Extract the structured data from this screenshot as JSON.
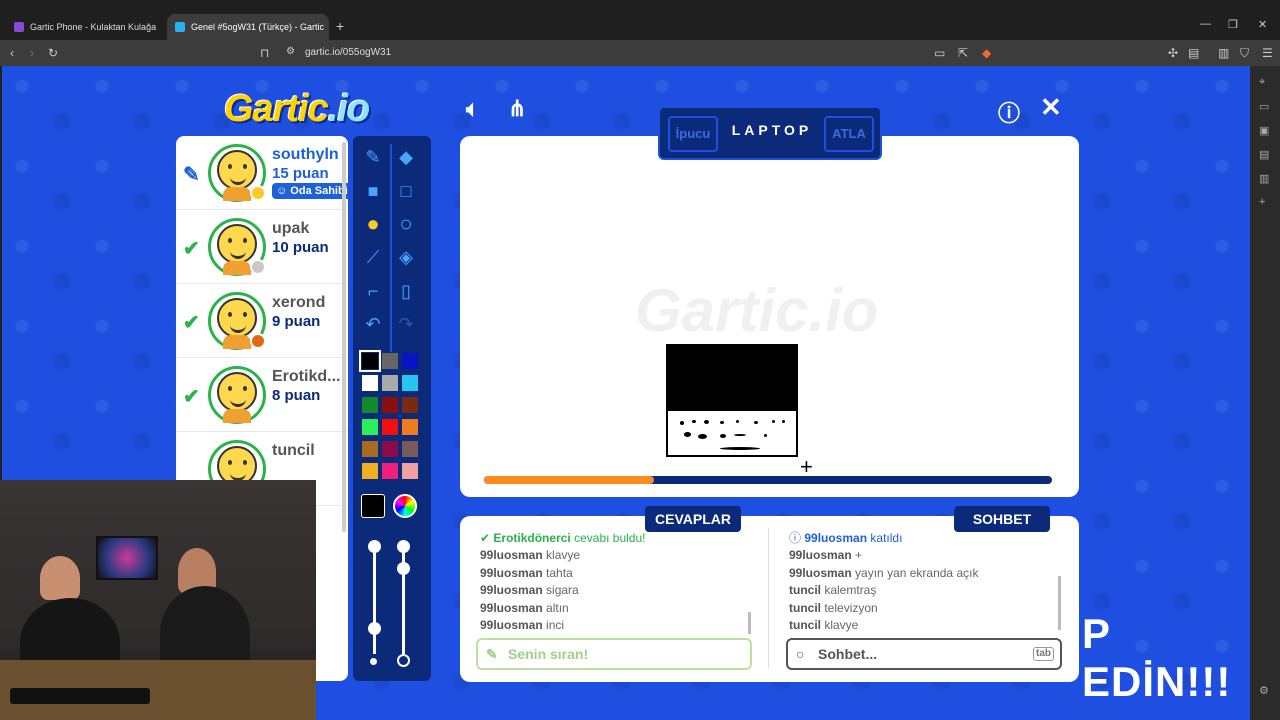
{
  "browser": {
    "tabs": [
      {
        "title": "Gartic Phone - Kulaktan Kulağa",
        "active": false
      },
      {
        "title": "Genel #5ogW31 (Türkçe) - Gartic",
        "active": true
      }
    ],
    "url": "gartic.io/055ogW31"
  },
  "game": {
    "logo": "Gartic",
    "logo_suffix": ".io",
    "word_hint_label": "İpucu",
    "word": "LAPTOP",
    "skip_label": "ATLA",
    "timer_fraction": 0.3,
    "tabs": {
      "answers": "CEVAPLAR",
      "chat": "SOHBET"
    },
    "players": [
      {
        "name": "southyln",
        "points": "15 puan",
        "status": "drawing",
        "badge": "Oda Sahibi",
        "dot": "#ffc928"
      },
      {
        "name": "upak",
        "points": "10 puan",
        "status": "guessed",
        "dot": "#c8c8c8"
      },
      {
        "name": "xerond",
        "points": "9 puan",
        "status": "guessed",
        "dot": "#e06a10"
      },
      {
        "name": "Erotikd...",
        "points": "8 puan",
        "status": "guessed",
        "dot": ""
      },
      {
        "name": "tuncil",
        "points": "",
        "status": "",
        "dot": ""
      }
    ],
    "palette": [
      "#000000",
      "#666666",
      "#0a12c8",
      "#ffffff",
      "#aaaaaa",
      "#27c6f0",
      "#128a2a",
      "#8a1010",
      "#7a2a10",
      "#2af05a",
      "#f01010",
      "#f07a20",
      "#a86a20",
      "#8a0a4a",
      "#7a5a5a",
      "#f0b020",
      "#f0207a",
      "#f0a0a0"
    ],
    "answers": [
      {
        "user": "Erotikdönerci",
        "text": "cevabı buldu!",
        "type": "ok"
      },
      {
        "user": "99luosman",
        "text": "klavye"
      },
      {
        "user": "99luosman",
        "text": "tahta"
      },
      {
        "user": "99luosman",
        "text": "sigara"
      },
      {
        "user": "99luosman",
        "text": "altın"
      },
      {
        "user": "99luosman",
        "text": "inci"
      }
    ],
    "chat": [
      {
        "user": "99luosman",
        "text": "katıldı",
        "type": "join"
      },
      {
        "user": "99luosman",
        "text": "+"
      },
      {
        "user": "99luosman",
        "text": "yayın yan ekranda açık"
      },
      {
        "user": "tuncil",
        "text": "kalemtraş"
      },
      {
        "user": "tuncil",
        "text": "televizyon"
      },
      {
        "user": "tuncil",
        "text": "klavye"
      }
    ],
    "answer_placeholder": "Senin sıran!",
    "chat_placeholder": "Sohbet...",
    "chat_key_hint": "tab"
  },
  "overlay_text": "P EDİN!!!"
}
